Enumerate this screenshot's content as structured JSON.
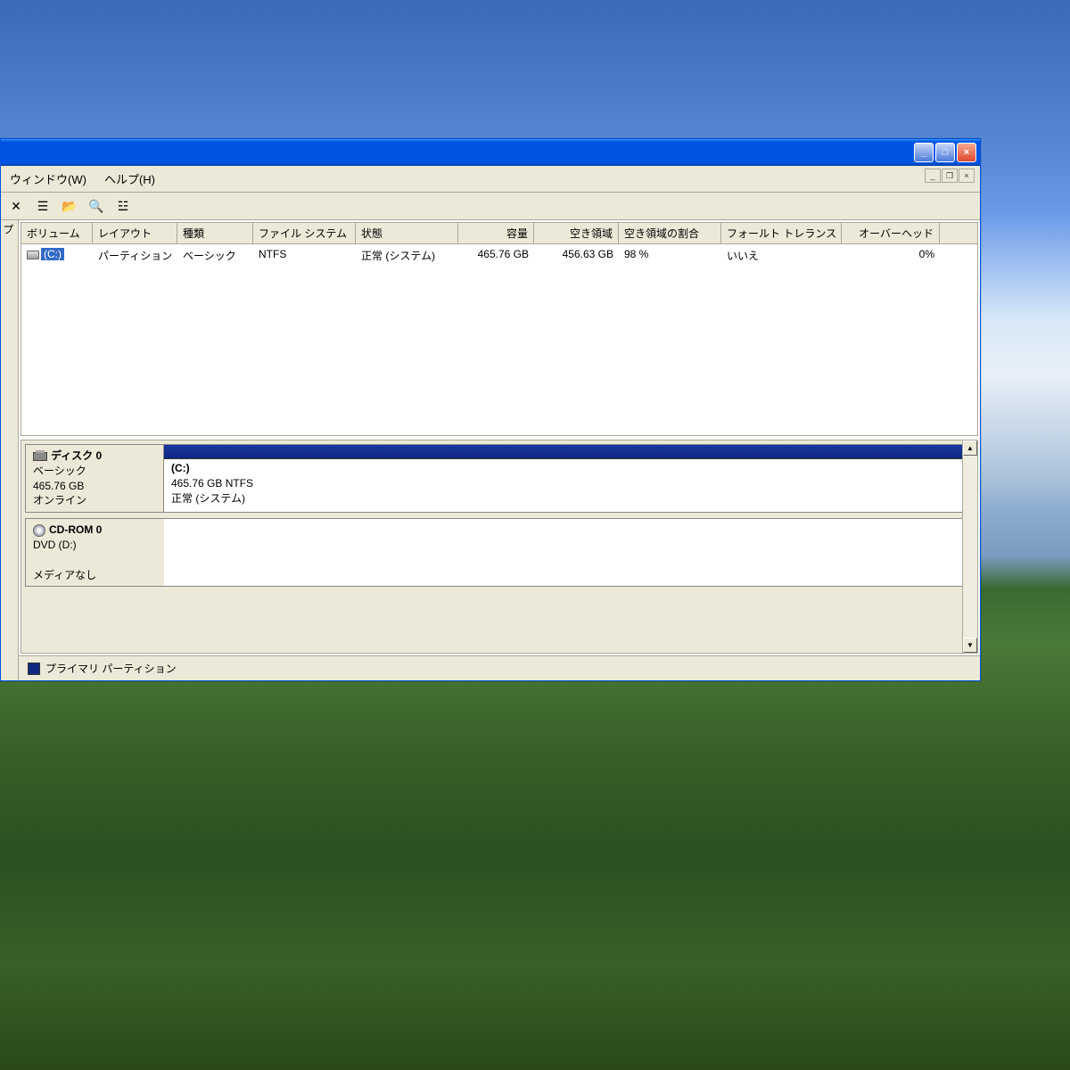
{
  "menu": {
    "window": "ウィンドウ(W)",
    "help": "ヘルプ(H)"
  },
  "columns": {
    "volume": "ボリューム",
    "layout": "レイアウト",
    "type": "種類",
    "filesystem": "ファイル システム",
    "status": "状態",
    "capacity": "容量",
    "free": "空き領域",
    "freepct": "空き領域の割合",
    "fault": "フォールト トレランス",
    "overhead": "オーバーヘッド"
  },
  "volume_row": {
    "label": "(C:)",
    "layout": "パーティション",
    "type": "ベーシック",
    "filesystem": "NTFS",
    "status": "正常 (システム)",
    "capacity": "465.76 GB",
    "free": "456.63 GB",
    "freepct": "98 %",
    "fault": "いいえ",
    "overhead": "0%"
  },
  "left_tab": "プ",
  "disk0": {
    "title": "ディスク 0",
    "type": "ベーシック",
    "size": "465.76 GB",
    "state": "オンライン",
    "part_label": "(C:)",
    "part_size": "465.76 GB NTFS",
    "part_status": "正常 (システム)"
  },
  "cdrom": {
    "title": "CD-ROM 0",
    "type": "DVD (D:)",
    "state": "メディアなし"
  },
  "legend": {
    "primary": "プライマリ パーティション"
  }
}
